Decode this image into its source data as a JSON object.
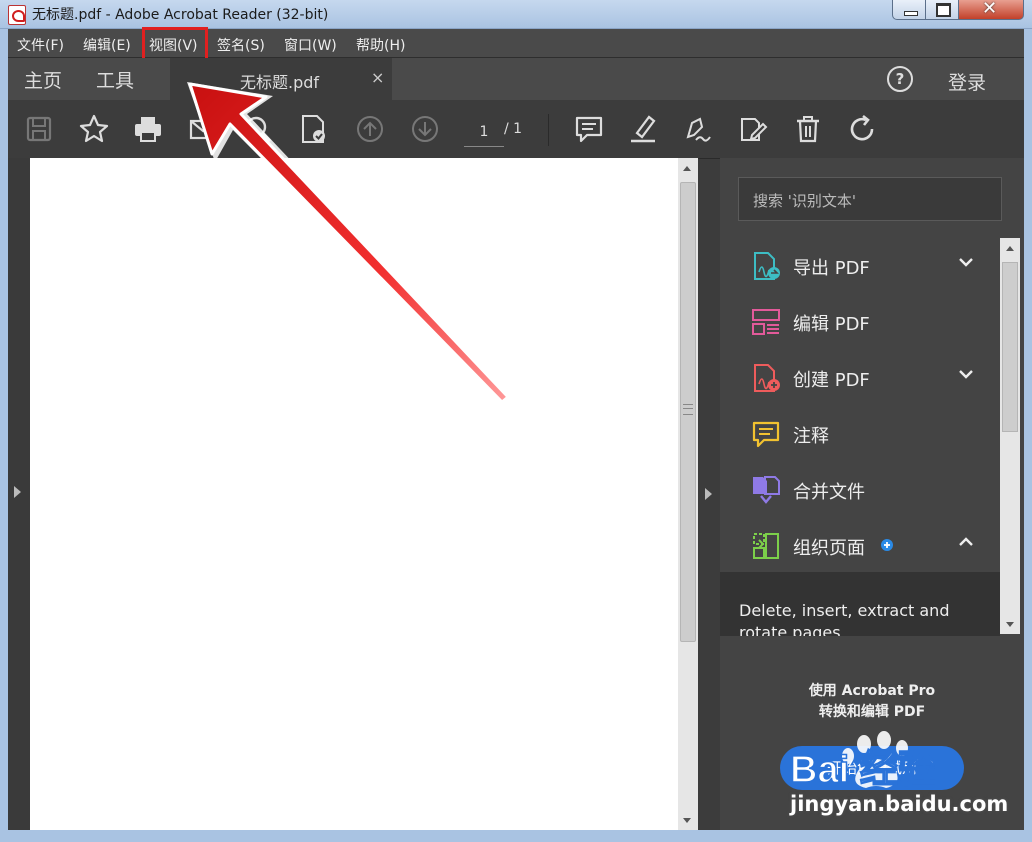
{
  "window": {
    "title": "无标题.pdf - Adobe Acrobat Reader (32-bit)",
    "close_glyph": "✕"
  },
  "menu": [
    {
      "label": "文件(F)"
    },
    {
      "label": "编辑(E)"
    },
    {
      "label": "视图(V)"
    },
    {
      "label": "签名(S)"
    },
    {
      "label": "窗口(W)"
    },
    {
      "label": "帮助(H)"
    }
  ],
  "tabs": {
    "home": "主页",
    "tools": "工具",
    "document": "无标题.pdf",
    "close_glyph": "×",
    "help_glyph": "?",
    "login": "登录"
  },
  "toolbar": {
    "page_current": "1",
    "page_total": "/ 1",
    "icons": [
      "save-icon",
      "star-icon",
      "print-icon",
      "email-icon",
      "zoom-icon",
      "ocr-icon",
      "page-up-icon",
      "page-down-icon",
      "comment-icon",
      "highlight-icon",
      "sign-icon",
      "fill-sign-icon",
      "delete-icon",
      "rotate-icon"
    ]
  },
  "right_pane": {
    "search_placeholder": "搜索 '识别文本'",
    "tools": [
      {
        "label": "导出 PDF",
        "icon": "export-pdf-icon",
        "color": "#3dbdc4",
        "chevron": "down"
      },
      {
        "label": "编辑 PDF",
        "icon": "edit-pdf-icon",
        "color": "#e35a9a",
        "chevron": ""
      },
      {
        "label": "创建 PDF",
        "icon": "create-pdf-icon",
        "color": "#ee5c5c",
        "chevron": "down"
      },
      {
        "label": "注释",
        "icon": "comment-tool-icon",
        "color": "#f2c230",
        "chevron": ""
      },
      {
        "label": "合并文件",
        "icon": "combine-files-icon",
        "color": "#8f7ae6",
        "chevron": ""
      },
      {
        "label": "组织页面",
        "icon": "organize-pages-icon",
        "color": "#7cd04a",
        "chevron": "up",
        "badge": true
      }
    ],
    "tool_description": "Delete, insert, extract and rotate pages",
    "upsell_line1": "使用 Acrobat Pro",
    "upsell_line2": "转换和编辑 PDF",
    "trial_button": "开始免费试用"
  },
  "watermark": {
    "brand": "Bai 经验",
    "site": "jingyan.baidu.com"
  },
  "colors": {
    "annotation_red": "#e02020",
    "accent_blue": "#2a73d9"
  }
}
